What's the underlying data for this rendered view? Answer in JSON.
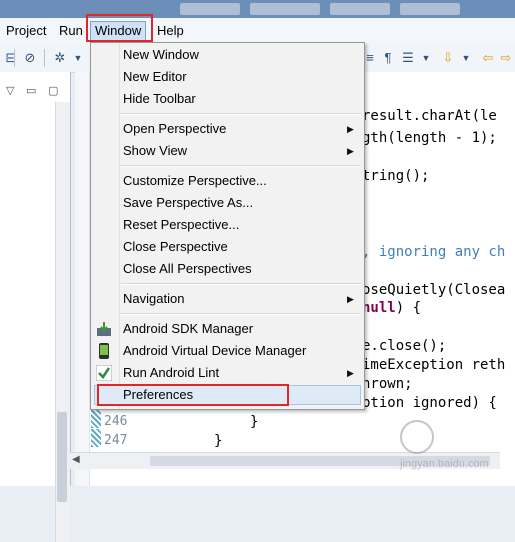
{
  "menubar": {
    "items": [
      "Project",
      "Run",
      "Window",
      "Help"
    ]
  },
  "window_menu": {
    "items": [
      "New Window",
      "New Editor",
      "Hide Toolbar",
      "Open Perspective",
      "Show View",
      "Customize Perspective...",
      "Save Perspective As...",
      "Reset Perspective...",
      "Close Perspective",
      "Close All Perspectives",
      "Navigation",
      "Android SDK Manager",
      "Android Virtual Device Manager",
      "Run Android Lint",
      "Preferences"
    ]
  },
  "editor": {
    "line_numbers": [
      "246",
      "247"
    ],
    "code": {
      "l1": "result.charAt(le",
      "l2": "gth(length - 1);",
      "l3": "tring();",
      "l4": ", ignoring any ch",
      "l5": "oseQuietly(Closea",
      "l6_kw": "null",
      "l6_rest": ") {",
      "l7": "e.close();",
      "l8": "imeException reth",
      "l9": "hrown;",
      "l10": "ption ignored) {",
      "l11": "}",
      "l12": "}"
    }
  },
  "watermark": {
    "text": "jingyan.baidu.com"
  },
  "colors": {
    "highlight_box": "#e2262a",
    "menu_bg": "#f2f2f2",
    "keyword": "#7f0055",
    "comment": "#3f7fbf"
  }
}
